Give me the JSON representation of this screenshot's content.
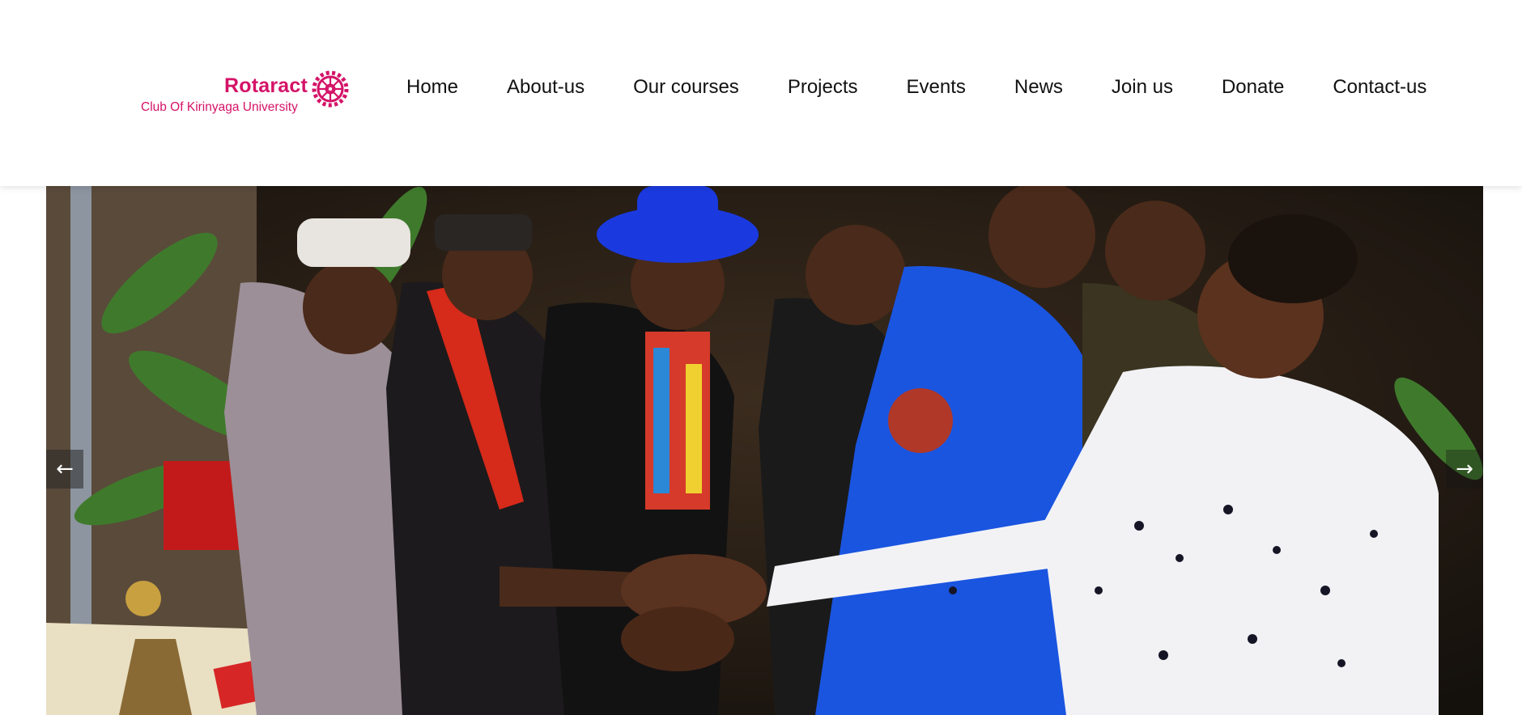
{
  "logo": {
    "name": "Rotaract",
    "subtitle": "Club Of Kirinyaga University",
    "wheel_icon": "rotary-wheel-icon",
    "color": "#d41367"
  },
  "nav": {
    "items": [
      {
        "label": "Home"
      },
      {
        "label": "About-us"
      },
      {
        "label": "Our courses"
      },
      {
        "label": "Projects"
      },
      {
        "label": "Events"
      },
      {
        "label": "News"
      },
      {
        "label": "Join us"
      },
      {
        "label": "Donate"
      },
      {
        "label": "Contact-us"
      }
    ]
  },
  "hero": {
    "image": "group-photo-hands-together",
    "prev_icon": "arrow-left-icon",
    "next_icon": "arrow-right-icon",
    "prev_glyph": "←",
    "next_glyph": "→"
  }
}
